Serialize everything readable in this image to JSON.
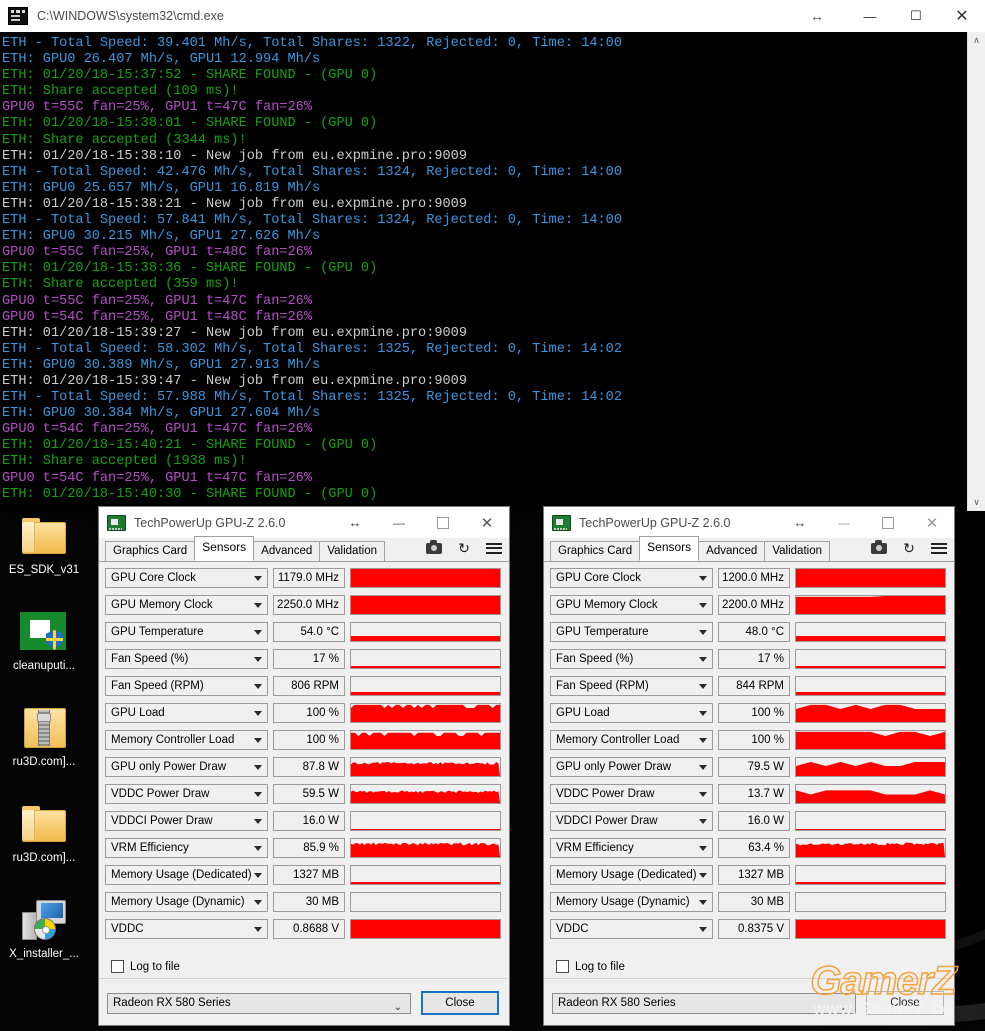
{
  "desktop": {
    "icons": [
      {
        "name": "ES_SDK_v31",
        "type": "folder-icon"
      },
      {
        "name": "cleanuputi...",
        "type": "amd-cleanup-icon"
      },
      {
        "name": "ru3D.com]...",
        "type": "zip-archive-icon"
      },
      {
        "name": "ru3D.com]...",
        "type": "folder-icon"
      },
      {
        "name": "X_installer_...",
        "type": "installer-icon"
      }
    ]
  },
  "cmd": {
    "title": "C:\\WINDOWS\\system32\\cmd.exe",
    "drag_hint": "↔",
    "minimize": "—",
    "maximize": "☐",
    "close": "✕",
    "scroll_up": "∧",
    "scroll_down": "∨",
    "lines": [
      {
        "c": "blue",
        "t": "ETH - Total Speed: 39.401 Mh/s, Total Shares: 1322, Rejected: 0, Time: 14:00"
      },
      {
        "c": "blue",
        "t": "ETH: GPU0 26.407 Mh/s, GPU1 12.994 Mh/s"
      },
      {
        "c": "green",
        "t": "ETH: 01/20/18-15:37:52 - SHARE FOUND - (GPU 0)"
      },
      {
        "c": "green",
        "t": "ETH: Share accepted (109 ms)!"
      },
      {
        "c": "magenta",
        "t": "GPU0 t=55C fan=25%, GPU1 t=47C fan=26%"
      },
      {
        "c": "green",
        "t": "ETH: 01/20/18-15:38:01 - SHARE FOUND - (GPU 0)"
      },
      {
        "c": "green",
        "t": "ETH: Share accepted (3344 ms)!"
      },
      {
        "c": "white",
        "t": "ETH: 01/20/18-15:38:10 - New job from eu.expmine.pro:9009"
      },
      {
        "c": "blue",
        "t": "ETH - Total Speed: 42.476 Mh/s, Total Shares: 1324, Rejected: 0, Time: 14:00"
      },
      {
        "c": "blue",
        "t": "ETH: GPU0 25.657 Mh/s, GPU1 16.819 Mh/s"
      },
      {
        "c": "white",
        "t": "ETH: 01/20/18-15:38:21 - New job from eu.expmine.pro:9009"
      },
      {
        "c": "blue",
        "t": "ETH - Total Speed: 57.841 Mh/s, Total Shares: 1324, Rejected: 0, Time: 14:00"
      },
      {
        "c": "blue",
        "t": "ETH: GPU0 30.215 Mh/s, GPU1 27.626 Mh/s"
      },
      {
        "c": "magenta",
        "t": "GPU0 t=55C fan=25%, GPU1 t=48C fan=26%"
      },
      {
        "c": "green",
        "t": "ETH: 01/20/18-15:38:36 - SHARE FOUND - (GPU 0)"
      },
      {
        "c": "green",
        "t": "ETH: Share accepted (359 ms)!"
      },
      {
        "c": "magenta",
        "t": "GPU0 t=55C fan=25%, GPU1 t=47C fan=26%"
      },
      {
        "c": "magenta",
        "t": "GPU0 t=54C fan=25%, GPU1 t=48C fan=26%"
      },
      {
        "c": "white",
        "t": "ETH: 01/20/18-15:39:27 - New job from eu.expmine.pro:9009"
      },
      {
        "c": "blue",
        "t": "ETH - Total Speed: 58.302 Mh/s, Total Shares: 1325, Rejected: 0, Time: 14:02"
      },
      {
        "c": "blue",
        "t": "ETH: GPU0 30.389 Mh/s, GPU1 27.913 Mh/s"
      },
      {
        "c": "white",
        "t": "ETH: 01/20/18-15:39:47 - New job from eu.expmine.pro:9009"
      },
      {
        "c": "blue",
        "t": "ETH - Total Speed: 57.988 Mh/s, Total Shares: 1325, Rejected: 0, Time: 14:02"
      },
      {
        "c": "blue",
        "t": "ETH: GPU0 30.384 Mh/s, GPU1 27.604 Mh/s"
      },
      {
        "c": "magenta",
        "t": "GPU0 t=54C fan=25%, GPU1 t=47C fan=26%"
      },
      {
        "c": "green",
        "t": "ETH: 01/20/18-15:40:21 - SHARE FOUND - (GPU 0)"
      },
      {
        "c": "green",
        "t": "ETH: Share accepted (1938 ms)!"
      },
      {
        "c": "magenta",
        "t": "GPU0 t=54C fan=25%, GPU1 t=47C fan=26%"
      },
      {
        "c": "green",
        "t": "ETH: 01/20/18-15:40:30 - SHARE FOUND - (GPU 0)"
      }
    ]
  },
  "gpuz_common": {
    "title": "TechPowerUp GPU-Z 2.6.0",
    "drag_hint": "↔",
    "minimize": "—",
    "close": "✕",
    "tabs": [
      "Graphics Card",
      "Sensors",
      "Advanced",
      "Validation"
    ],
    "active_tab": "Sensors",
    "icons": [
      "camera-icon",
      "refresh-icon",
      "menu-icon"
    ],
    "log_to_file": "Log to file",
    "card": "Radeon RX 580 Series",
    "close_button": "Close"
  },
  "gpuz_left": {
    "sensors": [
      {
        "name": "GPU Core Clock",
        "value": "1179.0 MHz",
        "fill": 100,
        "pattern": "solid"
      },
      {
        "name": "GPU Memory Clock",
        "value": "2250.0 MHz",
        "fill": 100,
        "pattern": "solid"
      },
      {
        "name": "GPU Temperature",
        "value": "54.0 °C",
        "fill": 30,
        "pattern": "solid"
      },
      {
        "name": "Fan Speed (%)",
        "value": "17 %",
        "fill": 12,
        "pattern": "solid"
      },
      {
        "name": "Fan Speed (RPM)",
        "value": "806 RPM",
        "fill": 18,
        "pattern": "solid"
      },
      {
        "name": "GPU Load",
        "value": "100 %",
        "fill": 95,
        "pattern": "dense-notch"
      },
      {
        "name": "Memory Controller Load",
        "value": "100 %",
        "fill": 90,
        "pattern": "dense-notch"
      },
      {
        "name": "GPU only Power Draw",
        "value": "87.8 W",
        "fill": 78,
        "pattern": "jitter"
      },
      {
        "name": "VDDC Power Draw",
        "value": "59.5 W",
        "fill": 70,
        "pattern": "jitter"
      },
      {
        "name": "VDDCI Power Draw",
        "value": "16.0 W",
        "fill": 9,
        "pattern": "solid"
      },
      {
        "name": "VRM Efficiency",
        "value": "85.9 %",
        "fill": 80,
        "pattern": "jitter"
      },
      {
        "name": "Memory Usage (Dedicated)",
        "value": "1327 MB",
        "fill": 14,
        "pattern": "solid"
      },
      {
        "name": "Memory Usage (Dynamic)",
        "value": "30 MB",
        "fill": 0,
        "pattern": "solid"
      },
      {
        "name": "VDDC",
        "value": "0.8688 V",
        "fill": 100,
        "pattern": "solid"
      }
    ]
  },
  "gpuz_right": {
    "sensors": [
      {
        "name": "GPU Core Clock",
        "value": "1200.0 MHz",
        "fill": 100,
        "pattern": "solid"
      },
      {
        "name": "GPU Memory Clock",
        "value": "2200.0 MHz",
        "fill": 100,
        "pattern": "step"
      },
      {
        "name": "GPU Temperature",
        "value": "48.0 °C",
        "fill": 28,
        "pattern": "solid"
      },
      {
        "name": "Fan Speed (%)",
        "value": "17 %",
        "fill": 12,
        "pattern": "solid"
      },
      {
        "name": "Fan Speed (RPM)",
        "value": "844 RPM",
        "fill": 18,
        "pattern": "solid"
      },
      {
        "name": "GPU Load",
        "value": "100 %",
        "fill": 95,
        "pattern": "sparse-notch"
      },
      {
        "name": "Memory Controller Load",
        "value": "100 %",
        "fill": 95,
        "pattern": "sparse-notch"
      },
      {
        "name": "GPU only Power Draw",
        "value": "79.5 W",
        "fill": 78,
        "pattern": "sparse-notch"
      },
      {
        "name": "VDDC Power Draw",
        "value": "13.7 W",
        "fill": 70,
        "pattern": "sparse-notch"
      },
      {
        "name": "VDDCI Power Draw",
        "value": "16.0 W",
        "fill": 9,
        "pattern": "solid"
      },
      {
        "name": "VRM Efficiency",
        "value": "63.4 %",
        "fill": 80,
        "pattern": "jitter"
      },
      {
        "name": "Memory Usage (Dedicated)",
        "value": "1327 MB",
        "fill": 14,
        "pattern": "solid"
      },
      {
        "name": "Memory Usage (Dynamic)",
        "value": "30 MB",
        "fill": 0,
        "pattern": "solid"
      },
      {
        "name": "VDDC",
        "value": "0.8375 V",
        "fill": 100,
        "pattern": "solid"
      }
    ]
  },
  "watermark": {
    "brand": "GamerZ",
    "url": "www.GamerZ.be"
  },
  "colors": {
    "accent": "#1773c8",
    "graph": "#fe0000",
    "console_blue": "#3a96dd",
    "console_green": "#13a10e",
    "console_magenta": "#b44ec5",
    "console_white": "#cccccc"
  }
}
